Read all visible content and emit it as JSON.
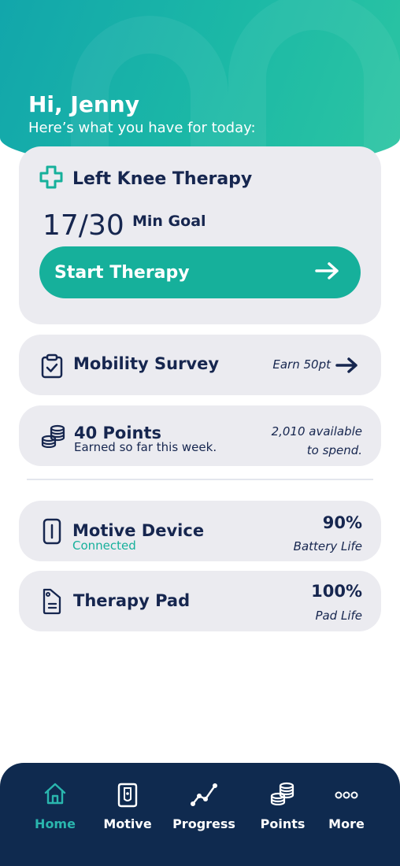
{
  "header": {
    "greeting": "Hi, Jenny",
    "subtitle": "Here’s what you have for today:"
  },
  "therapy": {
    "title": "Left Knee Therapy",
    "progress": "17/30",
    "goal_label": "Min Goal",
    "start_label": "Start Therapy",
    "icon": "medical-cross-icon"
  },
  "survey": {
    "title": "Mobility Survey",
    "reward": "Earn 50pt",
    "icon": "clipboard-check-icon"
  },
  "points": {
    "title": "40 Points",
    "subtitle": "Earned so far this week.",
    "available_line1": "2,010 available",
    "available_line2": "to spend.",
    "icon": "coins-icon"
  },
  "device": {
    "title": "Motive Device",
    "status": "Connected",
    "battery": "90%",
    "battery_label": "Battery Life",
    "icon": "device-icon"
  },
  "pad": {
    "title": "Therapy Pad",
    "life": "100%",
    "life_label": "Pad Life",
    "icon": "pad-tag-icon"
  },
  "nav": {
    "items": [
      {
        "label": "Home",
        "icon": "home-icon",
        "active": true
      },
      {
        "label": "Motive",
        "icon": "device-icon"
      },
      {
        "label": "Progress",
        "icon": "progress-graph-icon"
      },
      {
        "label": "Points",
        "icon": "coins-icon"
      },
      {
        "label": "More",
        "icon": "more-dots-icon"
      }
    ]
  },
  "colors": {
    "accent": "#16b09b",
    "navy": "#16264f",
    "nav_bg": "#0f2a4f",
    "card_bg": "#ebebf0",
    "connected": "#16b09b"
  }
}
